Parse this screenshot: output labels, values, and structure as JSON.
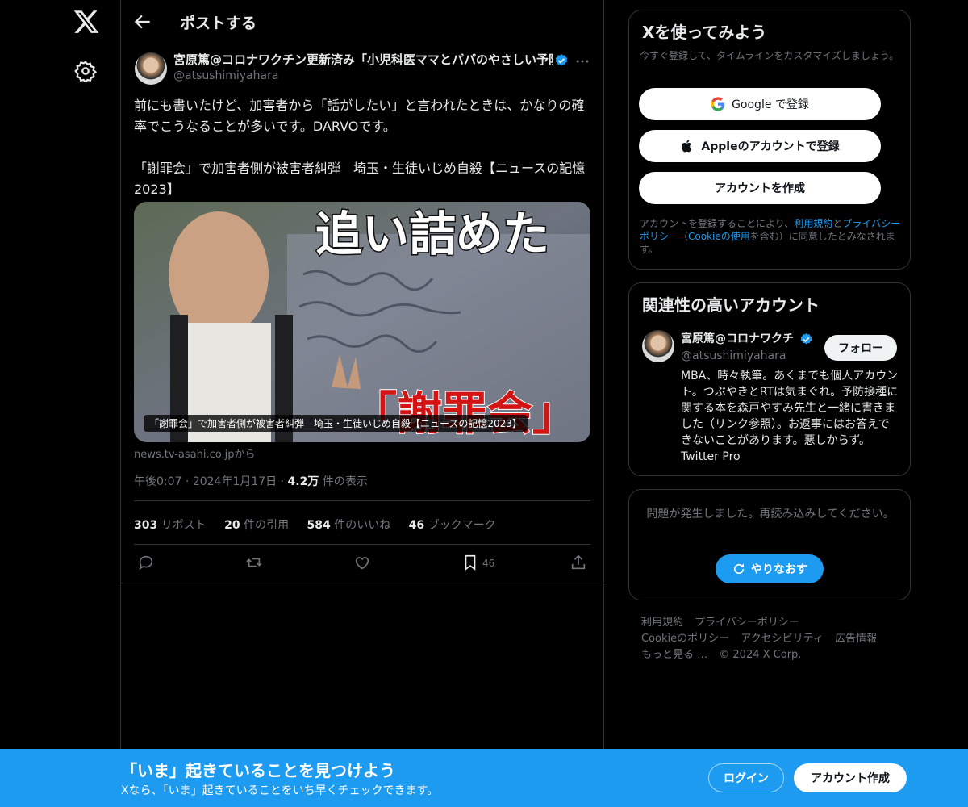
{
  "header": {
    "title": "ポストする"
  },
  "post": {
    "author_name": "宮原篤@コロナワクチン更新済み「小児科医ママとパパのやさしい予防接種BOOK」",
    "author_handle": "@atsushimiyahara",
    "text_line1": "前にも書いたけど、加害者から「話がしたい」と言われたときは、かなりの確率でこうなることが多いです。DARVOです。",
    "text_line2": "「謝罪会」で加害者側が被害者糾弾　埼玉・生徒いじめ自殺【ニュースの記憶2023】",
    "card": {
      "overlay_top": "追い詰めた",
      "overlay_bottom": "「謝罪会」",
      "caption": "「謝罪会」で加害者側が被害者糾弾　埼玉・生徒いじめ自殺【ニュースの記憶2023】",
      "domain": "news.tv-asahi.co.jpから"
    },
    "time": "午後0:07",
    "date": "2024年1月17日",
    "views_count": "4.2万",
    "views_label": "件の表示",
    "stats": {
      "reposts_count": "303",
      "reposts_label": "リポスト",
      "quotes_count": "20",
      "quotes_label": "件の引用",
      "likes_count": "584",
      "likes_label": "件のいいね",
      "bookmarks_count": "46",
      "bookmarks_label": "ブックマーク"
    },
    "actions": {
      "bookmark_count": "46"
    }
  },
  "signup": {
    "title": "Xを使ってみよう",
    "subtitle": "今すぐ登録して、タイムラインをカスタマイズしましょう。",
    "google_brand": "Google",
    "google_suffix": "で登録",
    "apple_label": "Appleのアカウントで登録",
    "create_label": "アカウントを作成",
    "legal_1": "アカウントを登録することにより、",
    "legal_terms": "利用規約",
    "legal_2": "と",
    "legal_privacy": "プライバシーポリシー",
    "legal_3": "（",
    "legal_cookie": "Cookieの使用",
    "legal_4": "を含む）に同意したとみなされます。"
  },
  "related": {
    "title": "関連性の高いアカウント",
    "name": "宮原篤@コロナワクチン更新済み",
    "handle": "@atsushimiyahara",
    "follow_label": "フォロー",
    "bio": "MBA、時々執筆。あくまでも個人アカウント。つぶやきとRTは気まぐれ。予防接種に関する本を森戸やすみ先生と一緒に書きました（リンク参照）。お返事にはお答えできないことがあります。悪しからず。Twitter Pro"
  },
  "error": {
    "message": "問題が発生しました。再読み込みしてください。",
    "retry_label": "やりなおす"
  },
  "footer": {
    "terms": "利用規約",
    "privacy": "プライバシーポリシー",
    "cookie": "Cookieのポリシー",
    "accessibility": "アクセシビリティ",
    "ads": "広告情報",
    "more": "もっと見る …",
    "copyright": "© 2024 X Corp."
  },
  "banner": {
    "title": "「いま」起きていることを見つけよう",
    "subtitle": "Xなら、「いま」起きていることをいち早くチェックできます。",
    "login_label": "ログイン",
    "create_label": "アカウント作成"
  },
  "colors": {
    "accent": "#1d9bf0",
    "background": "#000000",
    "border": "#2f3336",
    "muted": "#71767b",
    "text": "#e7e9ea"
  },
  "icons": [
    "x-logo-icon",
    "settings-icon",
    "back-arrow-icon",
    "verified-icon",
    "more-icon",
    "reply-icon",
    "repost-icon",
    "like-icon",
    "bookmark-icon",
    "share-icon",
    "google-icon",
    "apple-icon",
    "refresh-icon"
  ]
}
